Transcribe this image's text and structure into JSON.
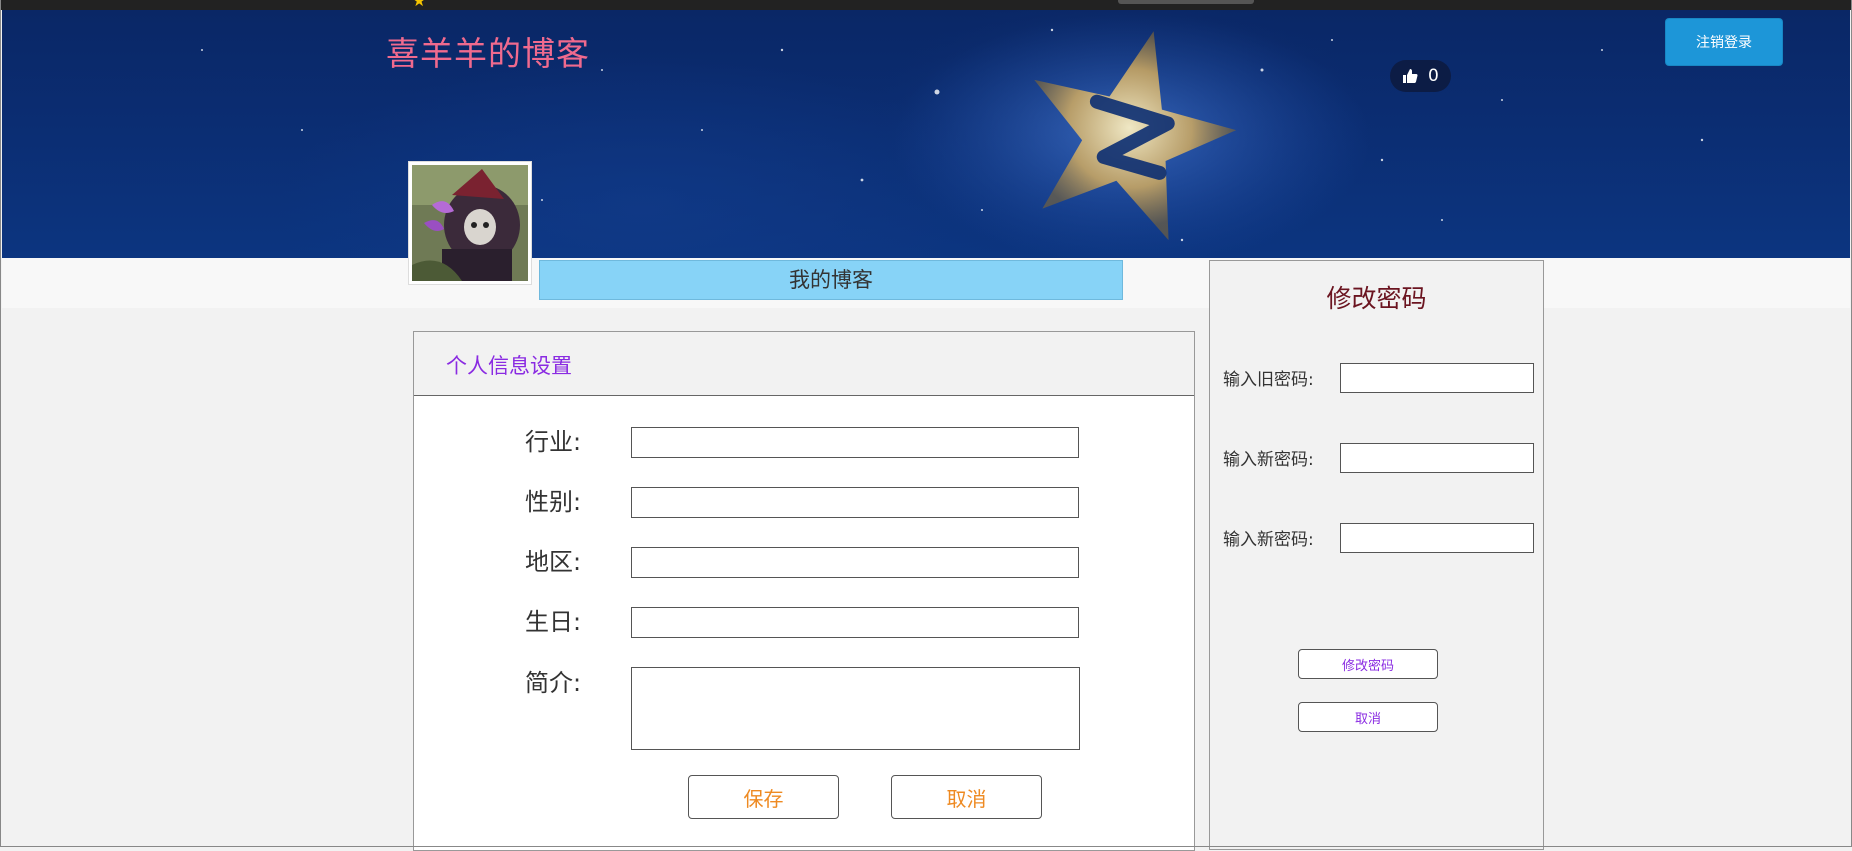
{
  "header": {
    "blog_title": "喜羊羊的博客",
    "logout_label": "注销登录",
    "like_count": "0",
    "like_icon": "thumbs-up-icon",
    "avatar_icon": "avatar-image"
  },
  "nav": {
    "my_blog_label": "我的博客"
  },
  "profile_form": {
    "title": "个人信息设置",
    "fields": [
      {
        "label": "行业:",
        "value": ""
      },
      {
        "label": "性别:",
        "value": ""
      },
      {
        "label": "地区:",
        "value": ""
      },
      {
        "label": "生日:",
        "value": ""
      },
      {
        "label": "简介:",
        "value": ""
      }
    ],
    "save_label": "保存",
    "cancel_label": "取消"
  },
  "password_form": {
    "title": "修改密码",
    "fields": [
      {
        "label": "输入旧密码:",
        "value": ""
      },
      {
        "label": "输入新密码:",
        "value": ""
      },
      {
        "label": "输入新密码:",
        "value": ""
      }
    ],
    "submit_label": "修改密码",
    "cancel_label": "取消"
  },
  "colors": {
    "banner": "#0b2d72",
    "title_pink": "#f06a8e",
    "logout_blue": "#1d96d8",
    "nav_blue": "#87d3f7",
    "purple": "#8a2be2",
    "orange": "#ee8a22",
    "maroon": "#6b1420"
  }
}
